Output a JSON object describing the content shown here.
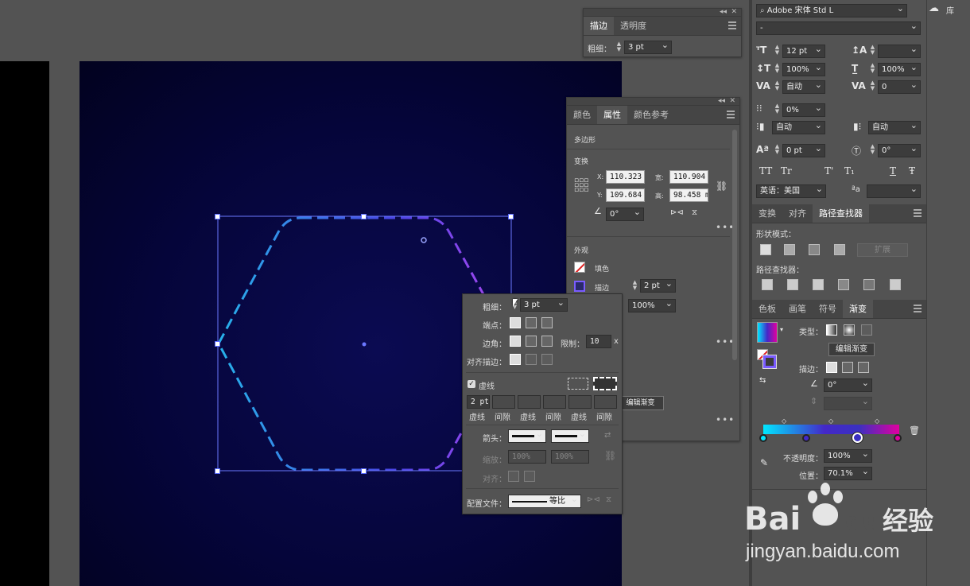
{
  "colors": {
    "artboard": "#05053a",
    "selection": "#6b78ff",
    "stroke_cyan": "#27b2ea",
    "stroke_violet": "#9a49f0",
    "grad_start": "#00e7ff",
    "grad_mid": "#4428c8",
    "grad_end": "#e000a0"
  },
  "stroke_panel": {
    "tabs": [
      "描边",
      "透明度"
    ],
    "weight_label": "粗细：",
    "weight_value": "3 pt"
  },
  "props_panel": {
    "tabs": [
      "颜色",
      "属性",
      "颜色参考"
    ],
    "object_type": "多边形",
    "transform_title": "变换",
    "x_label": "X:",
    "x_value": "110.323",
    "w_label": "宽:",
    "w_value": "110.904",
    "y_label": "Y:",
    "y_value": "109.684",
    "h_label": "高:",
    "h_value": "98.458 m",
    "angle_value": "0°",
    "appearance_title": "外观",
    "fill_label": "填色",
    "stroke_label": "描边",
    "stroke_value": "2 pt",
    "opacity_value": "100%",
    "edit_gradient": "编辑渐变",
    "more": "•••"
  },
  "stroke_popup": {
    "weight_label": "粗细：",
    "weight_value": "3 pt",
    "cap_label": "端点：",
    "corner_label": "边角：",
    "limit_label": "限制：",
    "limit_value": "10",
    "limit_unit": "x",
    "align_label": "对齐描边：",
    "dashed_label": "虚线",
    "dash_values": [
      "2 pt",
      "",
      "",
      "",
      "",
      ""
    ],
    "dash_labels": [
      "虚线",
      "间隙",
      "虚线",
      "间隙",
      "虚线",
      "间隙"
    ],
    "arrow_label": "箭头：",
    "scale_label": "缩放：",
    "scale1": "100%",
    "scale2": "100%",
    "align2_label": "对齐：",
    "profile_label": "配置文件：",
    "profile_value": "等比"
  },
  "char_panel": {
    "font_family": "Adobe 宋体 Std L",
    "font_style": "-",
    "size": "12 pt",
    "leading": "",
    "hscale": "100%",
    "vscale": "100%",
    "kerning": "自动",
    "tracking": "0",
    "tsume": "0%",
    "aki_left": "自动",
    "aki_right": "自动",
    "baseline": "0 pt",
    "rotation": "0°",
    "language": "英语：美国",
    "glyph_options": [
      "TT",
      "Tr",
      "T'",
      "T₁",
      "T",
      "Ŧ"
    ]
  },
  "pathfinder_panel": {
    "tabs": [
      "变换",
      "对齐",
      "路径查找器"
    ],
    "shape_modes": "形状模式：",
    "expand": "扩展",
    "pathfinders": "路径查找器："
  },
  "gradient_panel": {
    "tabs": [
      "色板",
      "画笔",
      "符号",
      "渐变"
    ],
    "type_label": "类型：",
    "edit_button": "编辑渐变",
    "stroke_label": "描边：",
    "angle_value": "0°",
    "opacity_label": "不透明度：",
    "opacity_value": "100%",
    "location_label": "位置：",
    "location_value": "70.1%"
  },
  "library": {
    "label": "库"
  },
  "watermark": {
    "brand_a": "Bai",
    "brand_b": "du",
    "brand_c": "经验",
    "url": "jingyan.baidu.com"
  }
}
